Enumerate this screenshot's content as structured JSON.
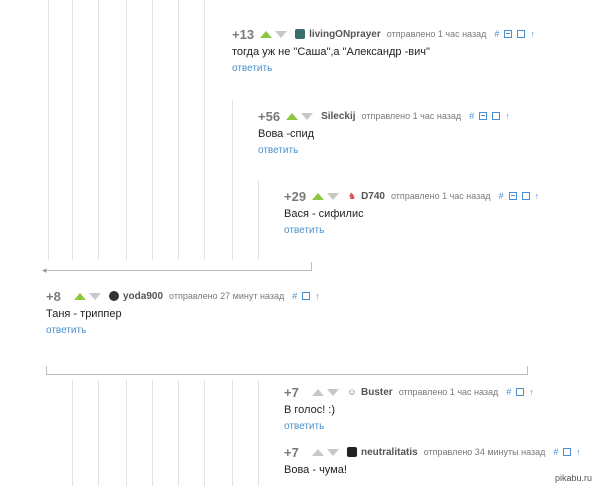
{
  "comments": [
    {
      "rating": "+13",
      "user": "livingONprayer",
      "meta": "отправлено 1 час назад",
      "text": "тогда уж не \"Саша\",а \"Александр -вич\"",
      "reply": "ответить"
    },
    {
      "rating": "+56",
      "user": "Sileckij",
      "meta": "отправлено 1 час назад",
      "text": "Вова -спид",
      "reply": "ответить"
    },
    {
      "rating": "+29",
      "user": "D740",
      "meta": "отправлено 1 час назад",
      "text": "Вася - сифилис",
      "reply": "ответить"
    },
    {
      "rating": "+8",
      "user": "yoda900",
      "meta": "отправлено 27 минут назад",
      "text": "Таня - триппер",
      "reply": "ответить"
    },
    {
      "rating": "+7",
      "user": "Buster",
      "meta": "отправлено 1 час назад",
      "text": "В голос! :)",
      "reply": "ответить"
    },
    {
      "rating": "+7",
      "user": "neutralitatis",
      "meta": "отправлено 34 минуты назад",
      "text": "Вова - чума!",
      "reply": ""
    }
  ],
  "tools": {
    "hash": "#",
    "up": "↑"
  },
  "watermark": "pikabu.ru"
}
